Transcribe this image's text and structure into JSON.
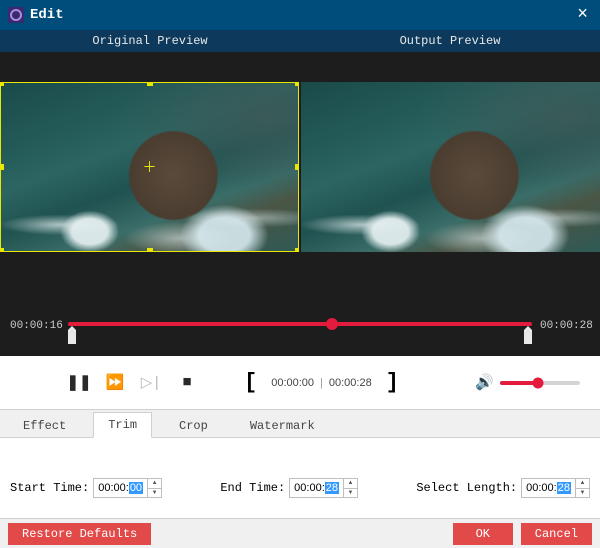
{
  "titlebar": {
    "title": "Edit"
  },
  "preview": {
    "original_label": "Original Preview",
    "output_label": "Output Preview"
  },
  "timeline": {
    "current": "00:00:16",
    "total": "00:00:28",
    "progress_pct": 57
  },
  "controls": {
    "range_start": "00:00:00",
    "range_end": "00:00:28",
    "volume_pct": 48
  },
  "tabs": {
    "items": [
      {
        "label": "Effect",
        "active": false
      },
      {
        "label": "Trim",
        "active": true
      },
      {
        "label": "Crop",
        "active": false
      },
      {
        "label": "Watermark",
        "active": false
      }
    ]
  },
  "trim_panel": {
    "start_label": "Start Time:",
    "start_prefix": "00:00:",
    "start_sel": "00",
    "end_label": "End Time:",
    "end_prefix": "00:00:",
    "end_sel": "28",
    "length_label": "Select Length:",
    "length_prefix": "00:00:",
    "length_sel": "28"
  },
  "footer": {
    "restore": "Restore Defaults",
    "ok": "OK",
    "cancel": "Cancel"
  }
}
